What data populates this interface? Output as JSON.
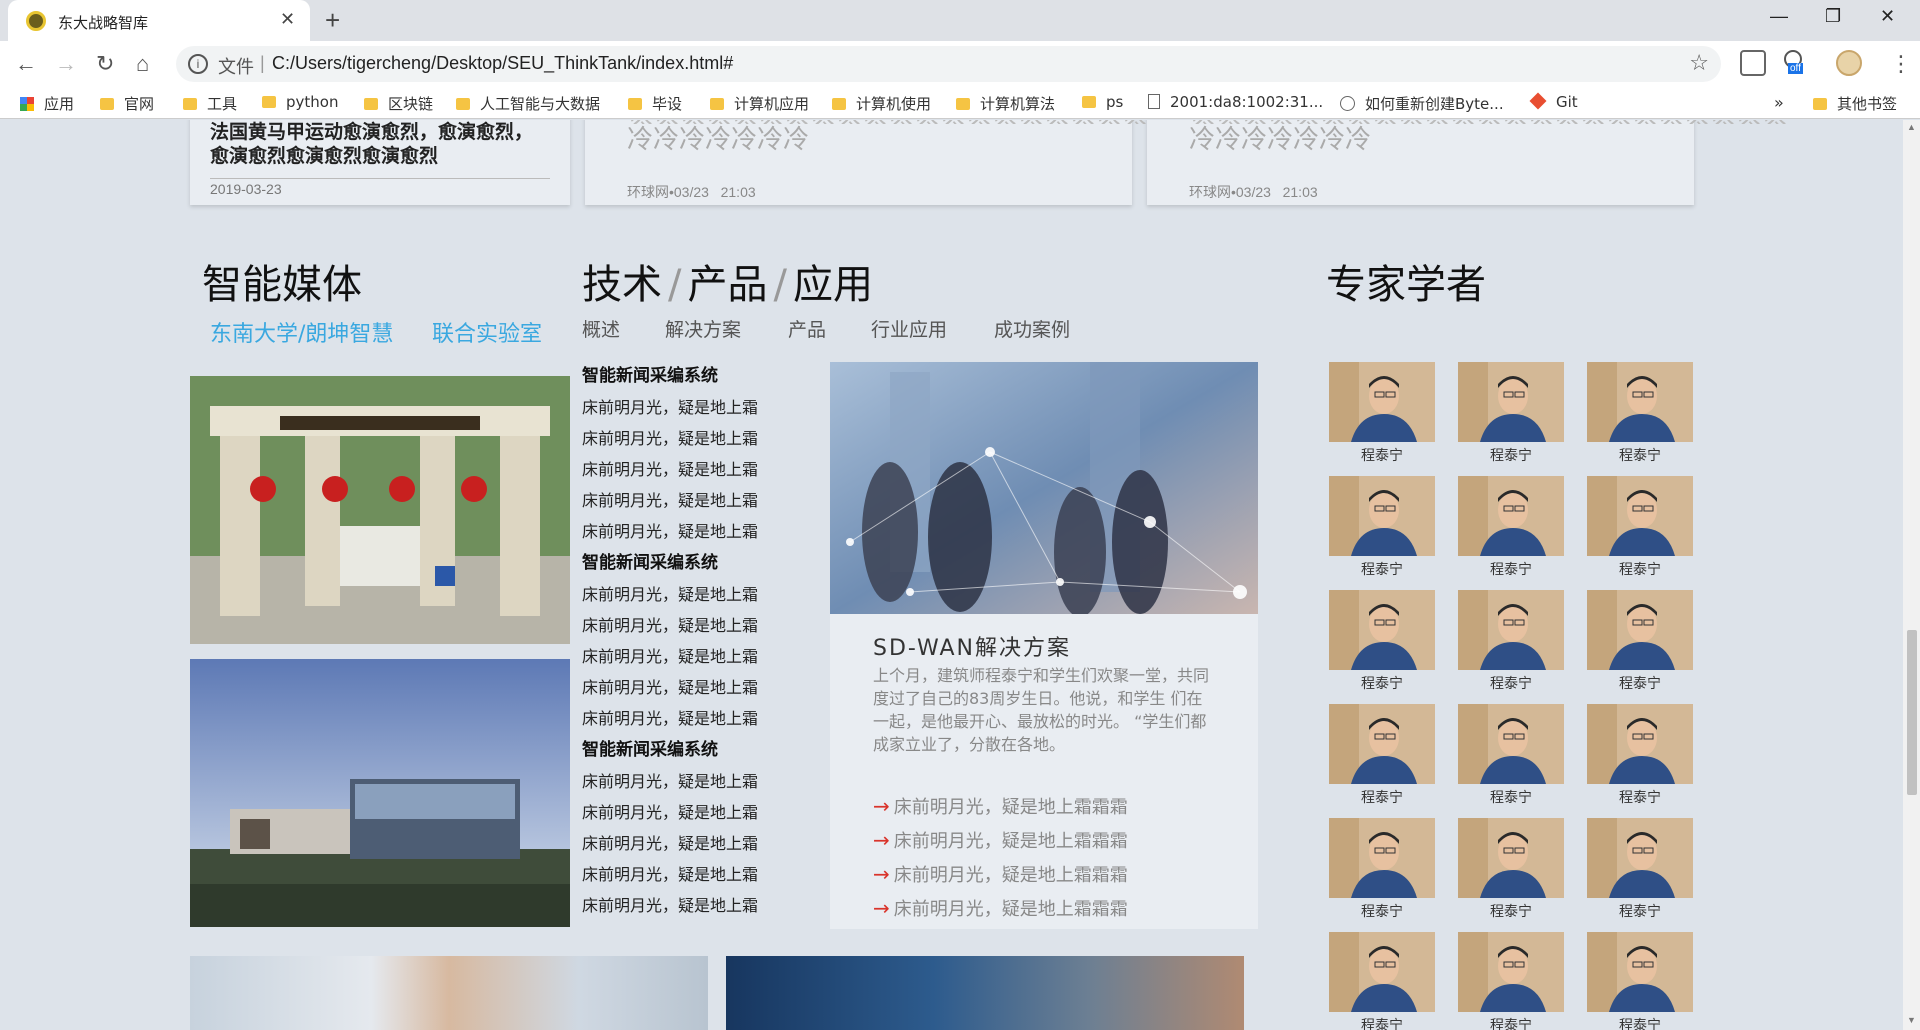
{
  "browser": {
    "tab_title": "东大战略智库",
    "scheme_label": "文件",
    "url": "C:/Users/tigercheng/Desktop/SEU_ThinkTank/index.html#",
    "ext_badge": "off",
    "bookmarks": [
      {
        "label": "应用",
        "icon": "apps-grid-icon"
      },
      {
        "label": "官网",
        "icon": "folder-icon"
      },
      {
        "label": "工具",
        "icon": "folder-icon"
      },
      {
        "label": "python",
        "icon": "folder-icon"
      },
      {
        "label": "区块链",
        "icon": "folder-icon"
      },
      {
        "label": "人工智能与大数据",
        "icon": "folder-icon"
      },
      {
        "label": "毕设",
        "icon": "folder-icon"
      },
      {
        "label": "计算机应用",
        "icon": "folder-icon"
      },
      {
        "label": "计算机使用",
        "icon": "folder-icon"
      },
      {
        "label": "计算机算法",
        "icon": "folder-icon"
      },
      {
        "label": "ps",
        "icon": "folder-icon"
      },
      {
        "label": "2001:da8:1002:31...",
        "icon": "page-icon"
      },
      {
        "label": "如何重新创建Byte...",
        "icon": "globe-icon"
      },
      {
        "label": "Git",
        "icon": "git-icon"
      }
    ],
    "more_bookmarks": "»",
    "other_bookmarks": "其他书签"
  },
  "top_news": [
    {
      "title_lines": [
        "法国黄马甲运动愈演愈烈，愈演愈烈，",
        "愈演愈烈愈演愈烈愈演愈烈"
      ],
      "date": "2019-03-23"
    },
    {
      "title_lines": [
        "冷冷冷冷冷冷冷"
      ],
      "source": "环球网•03/23",
      "time": "21:03"
    },
    {
      "title_lines": [
        "冷冷冷冷冷冷冷"
      ],
      "source": "环球网•03/23",
      "time": "21:03"
    }
  ],
  "media": {
    "heading": "智能媒体",
    "links": [
      "东南大学/朗坤智慧",
      "联合实验室"
    ]
  },
  "tech": {
    "heading_parts": [
      "技术",
      "产品",
      "应用"
    ],
    "slash": "/",
    "tabs": [
      "概述",
      "解决方案",
      "产品",
      "行业应用",
      "成功案例"
    ],
    "list_groups": [
      {
        "title": "智能新闻采编系统",
        "items": [
          "床前明月光，疑是地上霜",
          "床前明月光，疑是地上霜",
          "床前明月光，疑是地上霜",
          "床前明月光，疑是地上霜",
          "床前明月光，疑是地上霜"
        ]
      },
      {
        "title": "智能新闻采编系统",
        "items": [
          "床前明月光，疑是地上霜",
          "床前明月光，疑是地上霜",
          "床前明月光，疑是地上霜",
          "床前明月光，疑是地上霜",
          "床前明月光，疑是地上霜"
        ]
      },
      {
        "title": "智能新闻采编系统",
        "items": [
          "床前明月光，疑是地上霜",
          "床前明月光，疑是地上霜",
          "床前明月光，疑是地上霜",
          "床前明月光，疑是地上霜",
          "床前明月光，疑是地上霜"
        ]
      }
    ],
    "solution": {
      "title": "SD-WAN解决方案",
      "description": "上个月，建筑师程泰宁和学生们欢聚一堂，共同度过了自己的83周岁生日。他说，和学生 们在一起，是他最开心、最放松的时光。 “学生们都成家立业了，分散在各地。",
      "links": [
        "床前明月光，疑是地上霜霜霜",
        "床前明月光，疑是地上霜霜霜",
        "床前明月光，疑是地上霜霜霜",
        "床前明月光，疑是地上霜霜霜"
      ],
      "arrow": "→"
    }
  },
  "experts": {
    "heading": "专家学者",
    "people": [
      "程泰宁",
      "程泰宁",
      "程泰宁",
      "程泰宁",
      "程泰宁",
      "程泰宁",
      "程泰宁",
      "程泰宁",
      "程泰宁",
      "程泰宁",
      "程泰宁",
      "程泰宁",
      "程泰宁",
      "程泰宁",
      "程泰宁",
      "程泰宁",
      "程泰宁",
      "程泰宁"
    ]
  },
  "colors": {
    "accent_link": "#3aa8e0",
    "arrow_red": "#d9342b",
    "page_bg": "#dde3ea"
  }
}
